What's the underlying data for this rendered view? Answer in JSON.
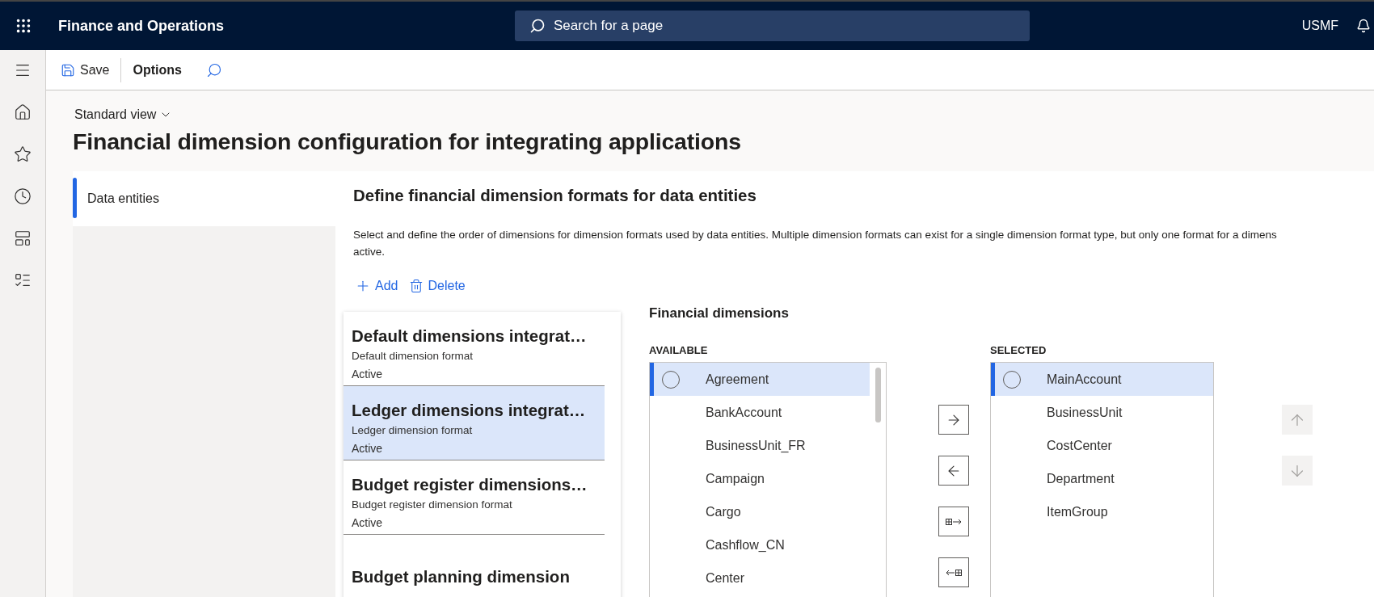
{
  "top_bar": {
    "app_title": "Finance and Operations",
    "search": {
      "placeholder": "Search for a page"
    },
    "company": "USMF"
  },
  "action_bar": {
    "save": "Save",
    "options": "Options"
  },
  "view_selector": "Standard view",
  "page_title": "Financial dimension configuration for integrating applications",
  "side_tabs": [
    {
      "label": "Data entities",
      "selected": true
    }
  ],
  "section": {
    "heading": "Define financial dimension formats for data entities",
    "description_lines": [
      "Select and define the order of dimensions for dimension formats used by data entities. Multiple dimension formats can exist for a single dimension format type, but only one format for a dimens",
      "active."
    ],
    "add": "Add",
    "delete": "Delete"
  },
  "formats": [
    {
      "title": "Default dimensions integrat…",
      "type": "Default dimension format",
      "status": "Active",
      "selected": false
    },
    {
      "title": "Ledger dimensions integrat…",
      "type": "Ledger dimension format",
      "status": "Active",
      "selected": true
    },
    {
      "title": "Budget register dimensions…",
      "type": "Budget register dimension format",
      "status": "Active",
      "selected": false
    },
    {
      "title": "Budget planning dimension",
      "selected": false
    }
  ],
  "dimensions": {
    "heading": "Financial dimensions",
    "available_label": "AVAILABLE",
    "available": [
      {
        "name": "Agreement",
        "selected": true
      },
      {
        "name": "BankAccount",
        "selected": false
      },
      {
        "name": "BusinessUnit_FR",
        "selected": false
      },
      {
        "name": "Campaign",
        "selected": false
      },
      {
        "name": "Cargo",
        "selected": false
      },
      {
        "name": "Cashflow_CN",
        "selected": false
      },
      {
        "name": "Center",
        "selected": false
      }
    ],
    "selected_label": "SELECTED",
    "selected": [
      {
        "name": "MainAccount",
        "selected": true
      },
      {
        "name": "BusinessUnit",
        "selected": false
      },
      {
        "name": "CostCenter",
        "selected": false
      },
      {
        "name": "Department",
        "selected": false
      },
      {
        "name": "ItemGroup",
        "selected": false
      }
    ],
    "move_buttons": [
      {
        "kind": "add"
      },
      {
        "kind": "remove"
      },
      {
        "kind": "add_all"
      },
      {
        "kind": "remove_all"
      }
    ],
    "order_buttons": [
      {
        "kind": "up",
        "disabled": true
      },
      {
        "kind": "down",
        "disabled": true
      }
    ]
  }
}
